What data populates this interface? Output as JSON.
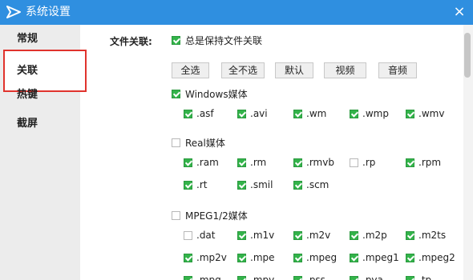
{
  "window": {
    "title": "系统设置",
    "close_icon": "×"
  },
  "sidebar": {
    "items": [
      {
        "label": "常规",
        "active": false
      },
      {
        "label": "关联",
        "active": true
      },
      {
        "label": "热键",
        "active": false
      },
      {
        "label": "截屏",
        "active": false
      }
    ]
  },
  "association": {
    "label": "文件关联:",
    "always_keep": {
      "label": "总是保持文件关联",
      "checked": true
    },
    "buttons": [
      "全选",
      "全不选",
      "默认",
      "视频",
      "音频"
    ],
    "groups": [
      {
        "name": "Windows媒体",
        "checked": true,
        "extensions": [
          {
            "ext": ".asf",
            "checked": true
          },
          {
            "ext": ".avi",
            "checked": true
          },
          {
            "ext": ".wm",
            "checked": true
          },
          {
            "ext": ".wmp",
            "checked": true
          },
          {
            "ext": ".wmv",
            "checked": true
          }
        ]
      },
      {
        "name": "Real媒体",
        "checked": false,
        "extensions": [
          {
            "ext": ".ram",
            "checked": true
          },
          {
            "ext": ".rm",
            "checked": true
          },
          {
            "ext": ".rmvb",
            "checked": true
          },
          {
            "ext": ".rp",
            "checked": false
          },
          {
            "ext": ".rpm",
            "checked": true
          },
          {
            "ext": ".rt",
            "checked": true
          },
          {
            "ext": ".smil",
            "checked": true
          },
          {
            "ext": ".scm",
            "checked": true
          }
        ]
      },
      {
        "name": "MPEG1/2媒体",
        "checked": false,
        "extensions": [
          {
            "ext": ".dat",
            "checked": false
          },
          {
            "ext": ".m1v",
            "checked": true
          },
          {
            "ext": ".m2v",
            "checked": true
          },
          {
            "ext": ".m2p",
            "checked": true
          },
          {
            "ext": ".m2ts",
            "checked": true
          },
          {
            "ext": ".mp2v",
            "checked": true
          },
          {
            "ext": ".mpe",
            "checked": true
          },
          {
            "ext": ".mpeg",
            "checked": true
          },
          {
            "ext": ".mpeg1",
            "checked": true
          },
          {
            "ext": ".mpeg2",
            "checked": true
          },
          {
            "ext": ".mpg",
            "checked": true
          },
          {
            "ext": ".mpv",
            "checked": true
          },
          {
            "ext": ".pss",
            "checked": true
          },
          {
            "ext": ".pva",
            "checked": true
          },
          {
            "ext": ".tp",
            "checked": true
          }
        ]
      }
    ]
  },
  "colors": {
    "titlebar": "#2f8fe0",
    "check": "#33b34a",
    "highlight": "#e0332d"
  }
}
